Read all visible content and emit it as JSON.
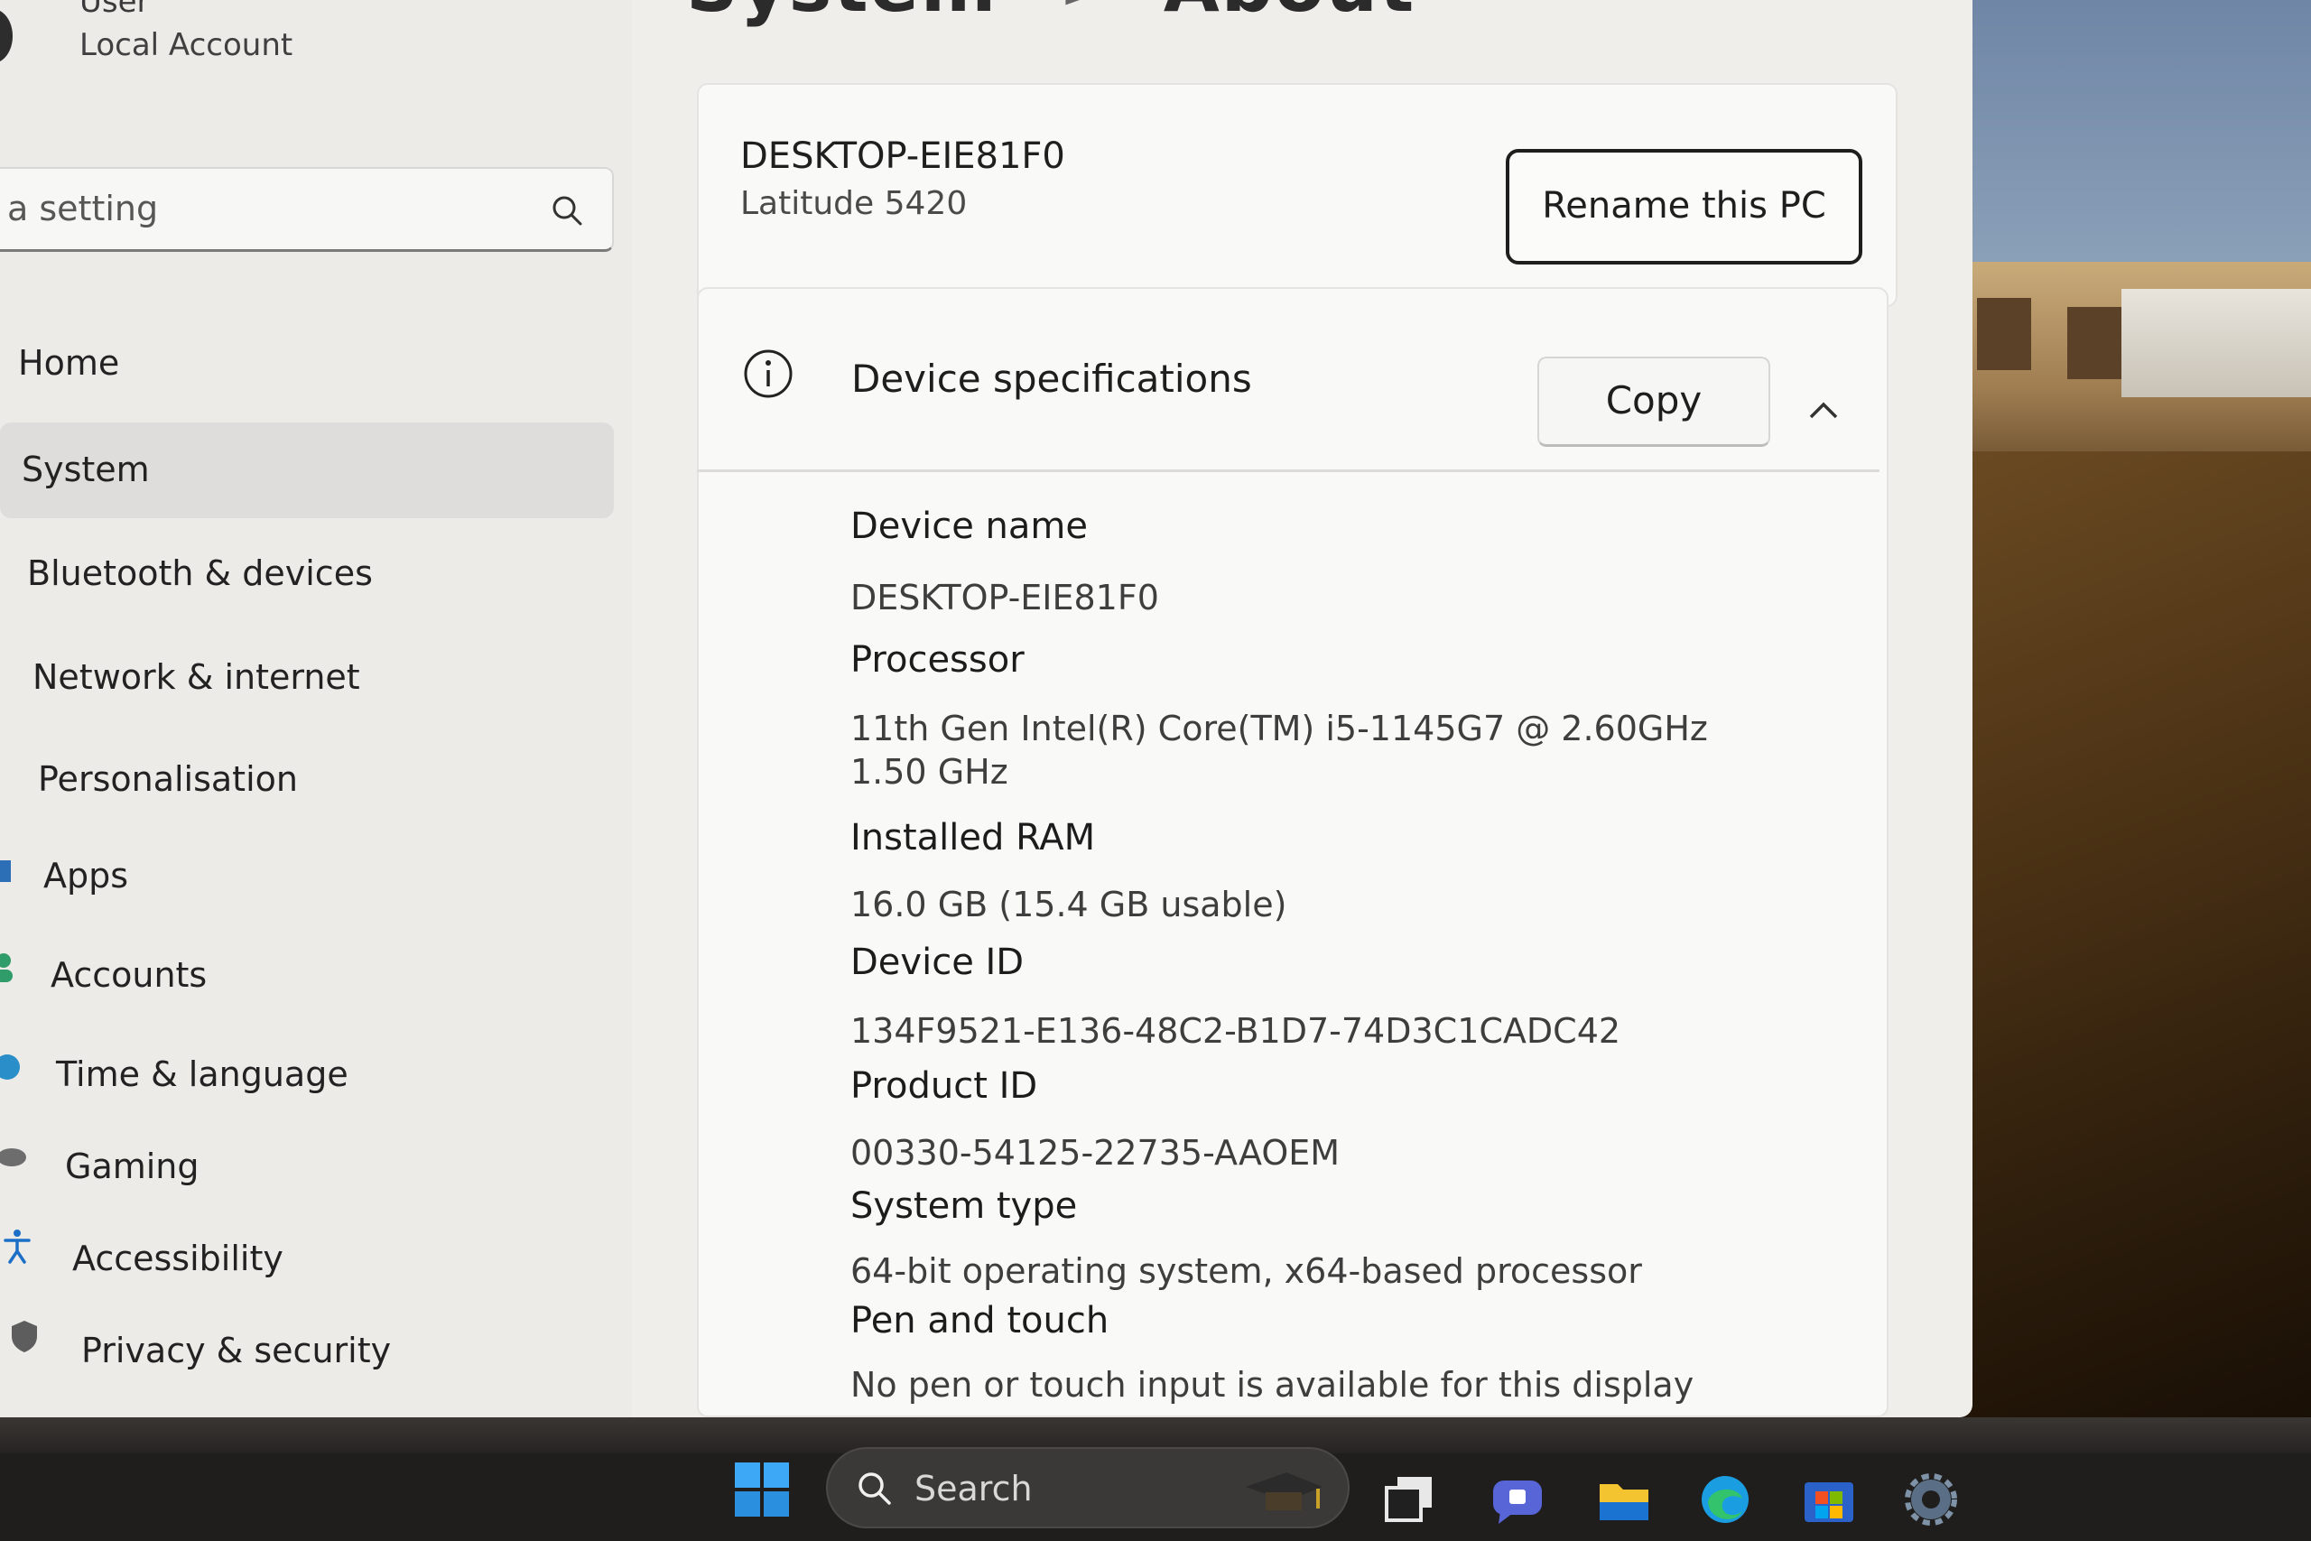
{
  "sidebar": {
    "user_name": "User",
    "account_type": "Local Account",
    "search_placeholder": "a setting",
    "items": [
      {
        "label": "Home"
      },
      {
        "label": "System"
      },
      {
        "label": "Bluetooth & devices"
      },
      {
        "label": "Network & internet"
      },
      {
        "label": "Personalisation"
      },
      {
        "label": "Apps"
      },
      {
        "label": "Accounts"
      },
      {
        "label": "Time & language"
      },
      {
        "label": "Gaming"
      },
      {
        "label": "Accessibility"
      },
      {
        "label": "Privacy & security"
      }
    ]
  },
  "header": {
    "breadcrumb_parent": "System",
    "breadcrumb_separator": ">",
    "title": "About"
  },
  "pc_card": {
    "device_name": "DESKTOP-EIE81F0",
    "model": "Latitude 5420",
    "rename_label": "Rename this PC"
  },
  "specs": {
    "title": "Device specifications",
    "copy_label": "Copy",
    "items": [
      {
        "label": "Device name",
        "value": "DESKTOP-EIE81F0"
      },
      {
        "label": "Processor",
        "value": "11th Gen Intel(R) Core(TM) i5-1145G7 @ 2.60GHz   1.50 GHz"
      },
      {
        "label": "Installed RAM",
        "value": "16.0 GB (15.4 GB usable)"
      },
      {
        "label": "Device ID",
        "value": "134F9521-E136-48C2-B1D7-74D3C1CADC42"
      },
      {
        "label": "Product ID",
        "value": "00330-54125-22735-AAOEM"
      },
      {
        "label": "System type",
        "value": "64-bit operating system, x64-based processor"
      },
      {
        "label": "Pen and touch",
        "value": "No pen or touch input is available for this display"
      }
    ]
  },
  "taskbar": {
    "search_placeholder": "Search",
    "apps": [
      "task-view-icon",
      "chat-icon",
      "file-explorer-icon",
      "edge-icon",
      "store-icon",
      "settings-icon"
    ]
  },
  "colors": {
    "window_bg": "#efeeeb",
    "card_bg": "#f9f9f8",
    "selected_nav": "#dedddb",
    "taskbar": "#1f1e1d",
    "accent_blue": "#1a73d0"
  }
}
